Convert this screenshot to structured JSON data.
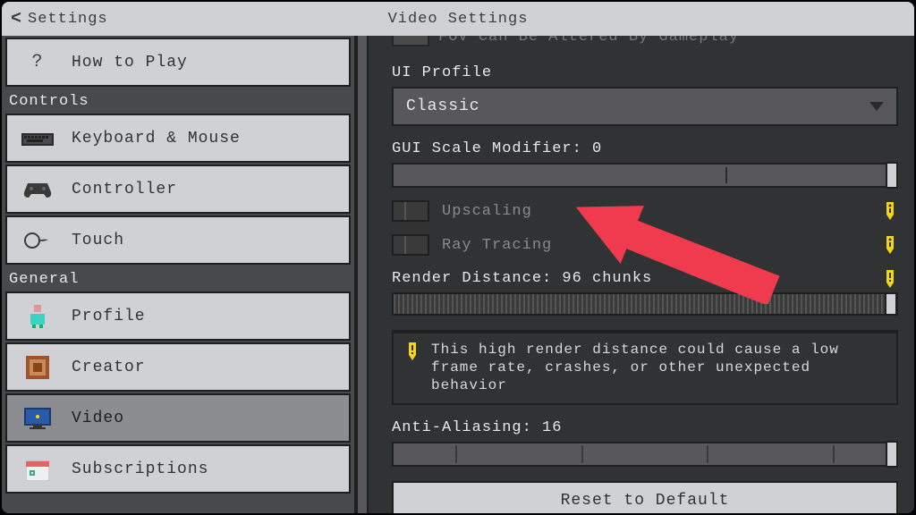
{
  "header": {
    "back_label": "Settings",
    "title": "Video Settings"
  },
  "sidebar": {
    "items": [
      {
        "label": "How to Play",
        "icon": "?",
        "active": false,
        "header": null
      },
      {
        "header": "Controls"
      },
      {
        "label": "Keyboard & Mouse",
        "icon": "keyboard",
        "active": false
      },
      {
        "label": "Controller",
        "icon": "controller",
        "active": false
      },
      {
        "label": "Touch",
        "icon": "touch",
        "active": false
      },
      {
        "header": "General"
      },
      {
        "label": "Profile",
        "icon": "profile",
        "active": false
      },
      {
        "label": "Creator",
        "icon": "creator",
        "active": false
      },
      {
        "label": "Video",
        "icon": "video",
        "active": true
      },
      {
        "label": "Subscriptions",
        "icon": "subscriptions",
        "active": false
      }
    ]
  },
  "main": {
    "cutoff_toggle_label": "FOV Can Be Altered By Gameplay",
    "ui_profile_label": "UI Profile",
    "ui_profile_value": "Classic",
    "gui_scale_label": "GUI Scale Modifier: 0",
    "upscaling_label": "Upscaling",
    "ray_tracing_label": "Ray Tracing",
    "render_distance_label": "Render Distance: 96 chunks",
    "render_distance_warning": "This high render distance could cause a low frame rate, crashes, or other unexpected behavior",
    "anti_aliasing_label": "Anti-Aliasing: 16",
    "reset_label": "Reset to Default"
  },
  "colors": {
    "accent_red": "#f03a4e",
    "warn_yellow": "#f5d51a"
  }
}
